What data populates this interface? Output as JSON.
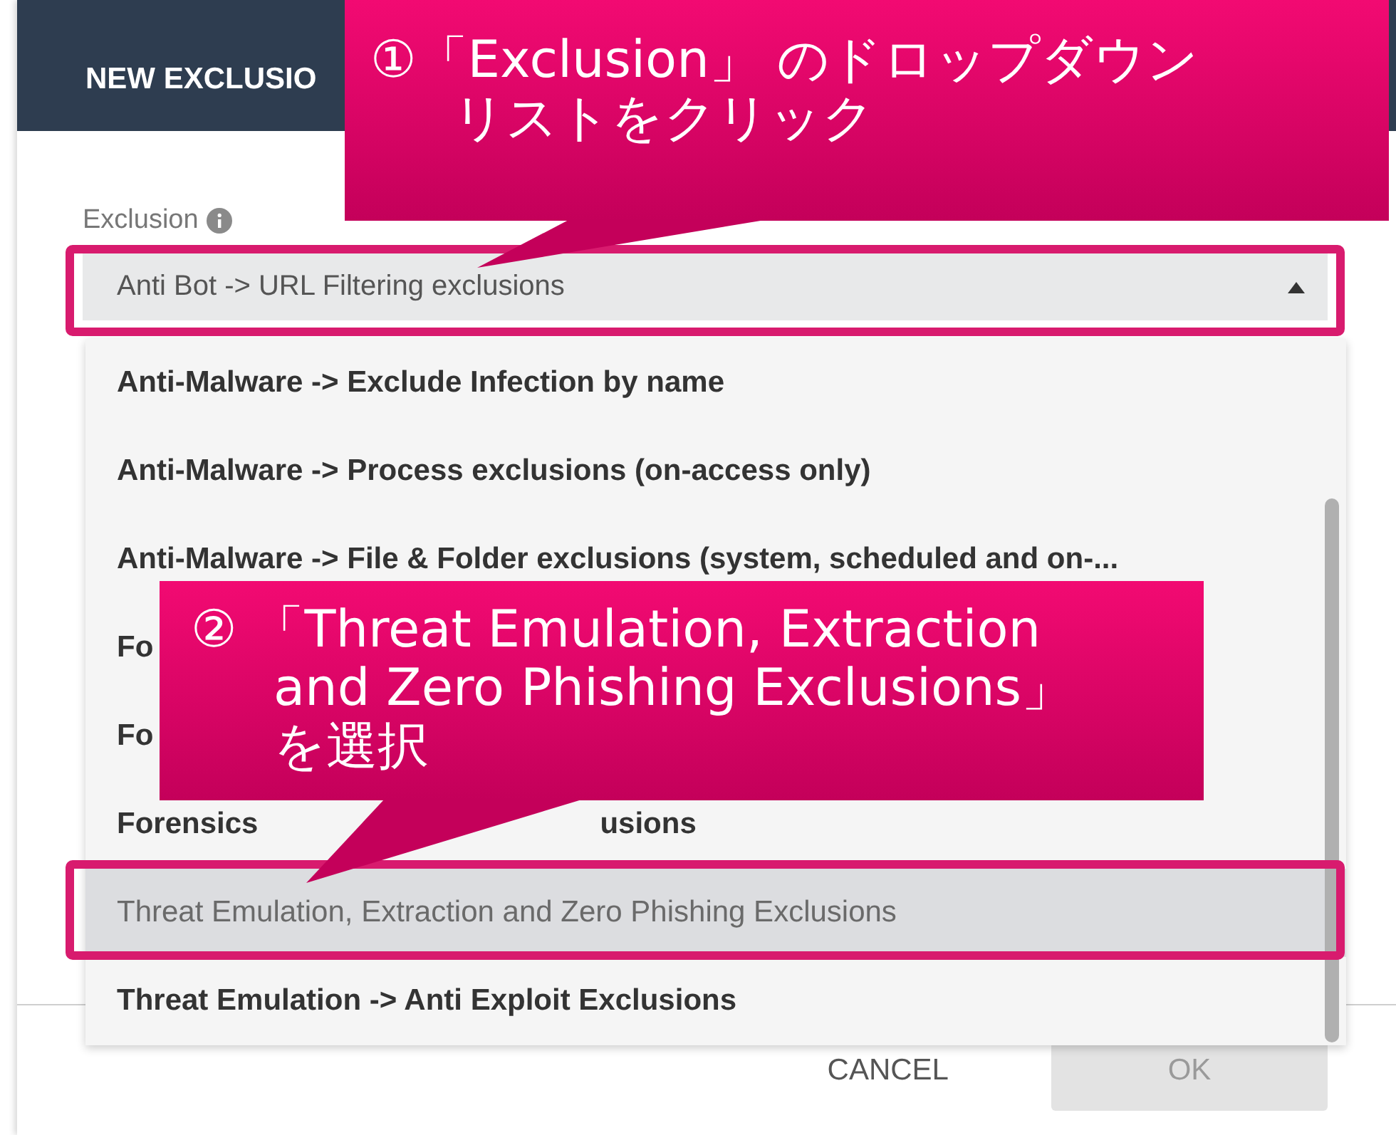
{
  "dialog": {
    "title": "NEW EXCLUSIO",
    "field": {
      "label": "Exclusion",
      "value": "Anti Bot -> URL Filtering exclusions",
      "expanded": true
    },
    "options": [
      {
        "parts": [
          "Anti-Malware -> Exclude Infection by name"
        ],
        "selected": false
      },
      {
        "parts": [
          "Anti-Malware -> Process exclusions (on-access only)"
        ],
        "selected": false
      },
      {
        "parts": [
          "Anti-Malware -> File & Folder exclusions (system, scheduled and on-..."
        ],
        "selected": false
      },
      {
        "parts": [
          "Fo"
        ],
        "selected": false
      },
      {
        "parts": [
          "Fo"
        ],
        "selected": false
      },
      {
        "parts": [
          "Forensics",
          "usions"
        ],
        "selected": false
      },
      {
        "parts": [
          "Threat Emulation, Extraction and Zero Phishing Exclusions"
        ],
        "selected": true
      },
      {
        "parts": [
          "Threat Emulation -> Anti Exploit Exclusions"
        ],
        "selected": false
      }
    ],
    "buttons": [
      {
        "label": "CANCEL",
        "disabled": false
      },
      {
        "label": "OK",
        "disabled": true
      }
    ]
  },
  "callouts": [
    {
      "lines": [
        "①「Exclusion」 のドロップダウン",
        "リストをクリック"
      ]
    },
    {
      "lines": [
        "② 「Threat Emulation, Extraction",
        "and Zero Phishing Exclusions」",
        "を選択"
      ]
    }
  ]
}
